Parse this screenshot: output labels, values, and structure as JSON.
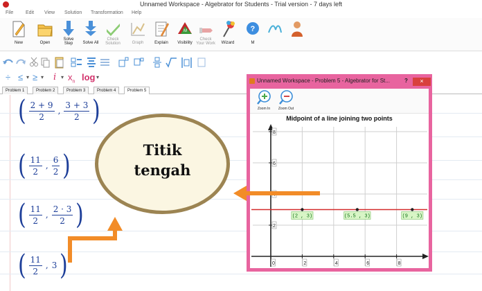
{
  "window": {
    "title": "Unnamed Workspace - Algebrator for Students - Trial version - 7 days left"
  },
  "menu": [
    "File",
    "Edit",
    "View",
    "Solution",
    "Transformation",
    "Help"
  ],
  "ribbon": [
    {
      "label": "New",
      "icon": "new-document-icon",
      "enabled": true
    },
    {
      "label": "Open",
      "icon": "open-folder-icon",
      "enabled": true
    },
    {
      "label": "Solve\nStep",
      "icon": "solve-step-icon",
      "enabled": true
    },
    {
      "label": "Solve All",
      "icon": "solve-all-icon",
      "enabled": true
    },
    {
      "label": "Check\nSolution",
      "icon": "check-solution-icon",
      "enabled": false
    },
    {
      "label": "Graph",
      "icon": "graph-icon",
      "enabled": false
    },
    {
      "label": "Explain",
      "icon": "explain-icon",
      "enabled": true
    },
    {
      "label": "Visibility",
      "icon": "visibility-icon",
      "enabled": true
    },
    {
      "label": "Check\nYour Work",
      "icon": "check-work-icon",
      "enabled": false
    },
    {
      "label": "Wizard",
      "icon": "wizard-icon",
      "enabled": true
    },
    {
      "label": "M",
      "icon": "help-icon",
      "enabled": true
    }
  ],
  "format_toolbar_2": {
    "divide": "÷",
    "le": "≤",
    "ge": "≥",
    "italic": "i",
    "subscript": "x",
    "subscript_mark": "n",
    "log": "log"
  },
  "tabs": [
    "Problem 1",
    "Problem 2",
    "Problem 3",
    "Problem 4",
    "Problem 5"
  ],
  "active_tab": 4,
  "steps": {
    "s1": {
      "n1": "2 + 9",
      "d1": "2",
      "n2": "3 + 3",
      "d2": "2"
    },
    "s2": {
      "n1": "11",
      "d1": "2",
      "n2": "6",
      "d2": "2"
    },
    "s3": {
      "n1": "11",
      "d1": "2",
      "n2": "2 · 3",
      "d2": "2"
    },
    "s4": {
      "n1": "11",
      "d1": "2",
      "v2": "3"
    },
    "comma": ","
  },
  "callout": {
    "line1": "Titik",
    "line2": "tengah"
  },
  "graph_window": {
    "title": "Unnamed Workspace - Problem 5 - Algebrator for St...",
    "help": "?",
    "close": "×",
    "zoom_in": "Zoom In",
    "zoom_out": "Zoom Out",
    "graph_title": "Midpoint of a line joining two points",
    "x_ticks": [
      0,
      2,
      4,
      6,
      8
    ],
    "y_ticks": [
      2,
      4,
      6,
      8
    ],
    "line_y": 3,
    "points": [
      {
        "x": 2,
        "y": 3,
        "label": "(2 , 3)"
      },
      {
        "x": 5.5,
        "y": 3,
        "label": "(5.5 , 3)"
      },
      {
        "x": 9,
        "y": 3,
        "label": "(9 , 3)"
      }
    ],
    "colors": {
      "line": "#d42a2a",
      "point_label_bg": "#d8f5c6",
      "point_label_fg": "#0b6e12",
      "frame": "#e8649f"
    }
  },
  "colors": {
    "arrow": "#f28c28",
    "ellipse_fill": "#fbf6e2",
    "ellipse_stroke": "#9c8452",
    "math": "#1e3f99"
  }
}
